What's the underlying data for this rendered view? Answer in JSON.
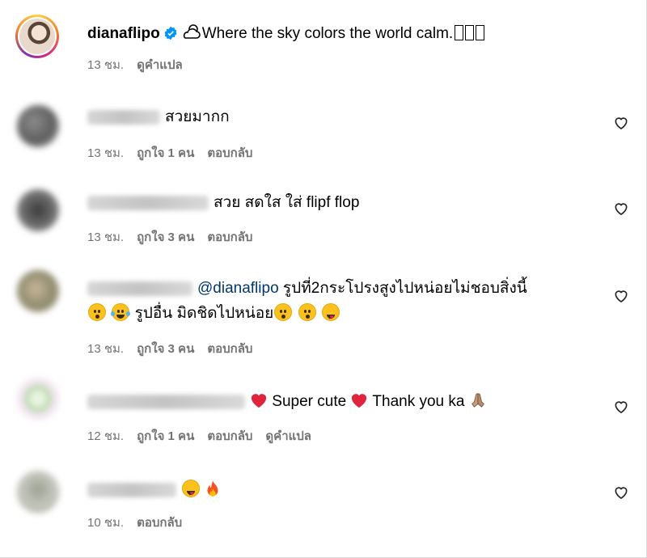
{
  "post": {
    "author": "dianaflipo",
    "caption": "Where the sky colors the world calm.",
    "time": "13 ชม.",
    "translate": "ดูคำแปล"
  },
  "labels": {
    "reply": "ตอบกลับ"
  },
  "comments": [
    {
      "text": "สวยมากก",
      "time": "13 ชม.",
      "likes": "ถูกใจ 1 คน"
    },
    {
      "text": "สวย สดใส ใส่ flipf flop",
      "time": "13 ชม.",
      "likes": "ถูกใจ 3 คน"
    },
    {
      "mention": "@dianaflipo",
      "text": "รูปที่2กระโปรงสูงไปหน่อยไม่ชอบสิ่งนี้",
      "text2": "รูปอื่น มิดชิดไปหน่อย",
      "time": "13 ชม.",
      "likes": "ถูกใจ 3 คน"
    },
    {
      "text": "Super cute",
      "text_b": "Thank you ka",
      "time": "12 ชม.",
      "likes": "ถูกใจ 1 คน",
      "translate": "ดูคำแปล"
    },
    {
      "time": "10 ชม."
    }
  ],
  "icons": {
    "like": "heart-outline-icon",
    "verified": "verified-badge-icon",
    "weather": "cloud-sun-icon"
  },
  "colors": {
    "meta": "#737373",
    "mention": "#00376b",
    "verified": "#0095f6"
  }
}
